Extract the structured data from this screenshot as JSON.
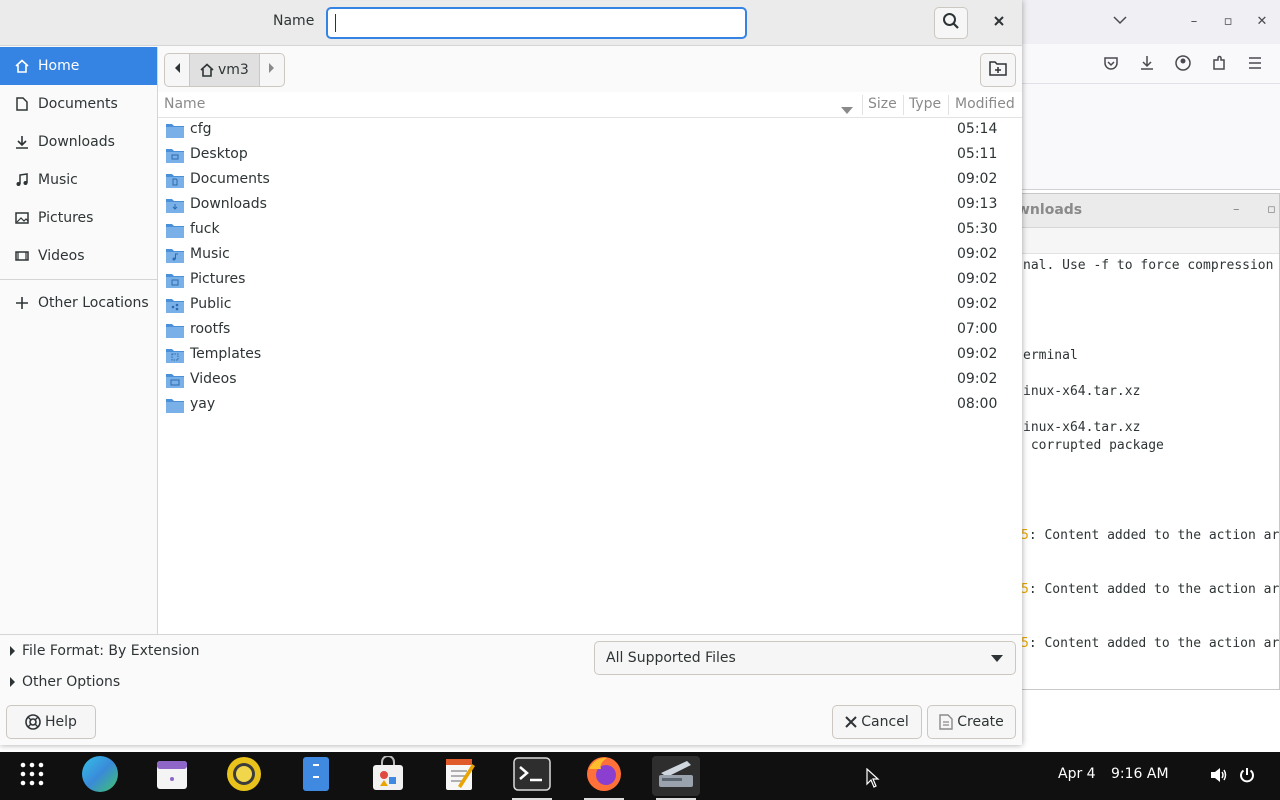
{
  "dialog": {
    "name_label": "Name",
    "name_value": "",
    "name_placeholder": ""
  },
  "sidebar": {
    "items": [
      {
        "label": "Home",
        "icon": "home-icon",
        "active": true
      },
      {
        "label": "Documents",
        "icon": "document-icon"
      },
      {
        "label": "Downloads",
        "icon": "download-icon"
      },
      {
        "label": "Music",
        "icon": "music-icon"
      },
      {
        "label": "Pictures",
        "icon": "picture-icon"
      },
      {
        "label": "Videos",
        "icon": "video-icon"
      }
    ],
    "other_locations": "Other Locations"
  },
  "pathbar": {
    "crumb": "vm3"
  },
  "columns": {
    "name": "Name",
    "size": "Size",
    "type": "Type",
    "modified": "Modified"
  },
  "files": [
    {
      "name": "cfg",
      "modified": "05:14"
    },
    {
      "name": "Desktop",
      "modified": "05:11"
    },
    {
      "name": "Documents",
      "modified": "09:02"
    },
    {
      "name": "Downloads",
      "modified": "09:13"
    },
    {
      "name": "fuck",
      "modified": "05:30"
    },
    {
      "name": "Music",
      "modified": "09:02"
    },
    {
      "name": "Pictures",
      "modified": "09:02"
    },
    {
      "name": "Public",
      "modified": "09:02"
    },
    {
      "name": "rootfs",
      "modified": "07:00"
    },
    {
      "name": "Templates",
      "modified": "09:02"
    },
    {
      "name": "Videos",
      "modified": "09:02"
    },
    {
      "name": "yay",
      "modified": "08:00"
    }
  ],
  "bottom": {
    "file_format": "File Format: By Extension",
    "other_options": "Other Options",
    "filter": "All Supported Files",
    "help": "Help",
    "cancel": "Cancel",
    "create": "Create"
  },
  "terminal": {
    "title": "wnloads",
    "lines": [
      "nal. Use -f to force compression",
      "erminal",
      "inux-x64.tar.xz",
      "inux-x64.tar.xz",
      " corrupted package",
      ": Content added to the action ar",
      ": Content added to the action ar",
      ": Content added to the action ar"
    ],
    "accent_char": "5"
  },
  "taskbar": {
    "date": "Apr 4",
    "time": "9:16 AM"
  },
  "colors": {
    "accent": "#3584e4",
    "folder": "#4a90d9",
    "taskbar": "#101010"
  }
}
